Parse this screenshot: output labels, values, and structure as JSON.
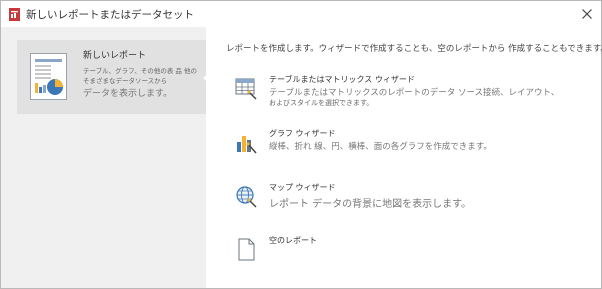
{
  "window": {
    "title": "新しいレポートまたはデータセット"
  },
  "sidebar": {
    "item": {
      "title": "新しいレポート",
      "line1": "テーブル、グラフ、その他の表 品 他の",
      "line2": "そまざまなデータソースから",
      "line3": "データを表示します。"
    }
  },
  "main": {
    "intro": "レポートを作成します。ウィザードで作成することも、空のレポートから 作成することもできます。",
    "options": [
      {
        "title": "テーブルまたはマトリックス ウィザード",
        "desc1": "テーブルまたはマトリックスのレポートのデータ ソース接続、レイアウト、",
        "desc2": "およびスタイルを選択できます。",
        "icon": "table-wizard-icon"
      },
      {
        "title": "グラフ ウィザード",
        "desc1": "縦棒、折れ 線、円、横棒、面の各グラフを作成できます。",
        "icon": "chart-wizard-icon"
      },
      {
        "title": "マップ ウィザード",
        "desc1": "レポート データの背景に地図を表示します。",
        "icon": "map-wizard-icon"
      },
      {
        "title": "空のレポート",
        "icon": "blank-report-icon"
      }
    ]
  },
  "colors": {
    "sidebar_bg": "#f0f0f0",
    "selected_bg": "#e1e1e1",
    "app_icon_red": "#c8393b",
    "accent_blue": "#3c78b5"
  }
}
